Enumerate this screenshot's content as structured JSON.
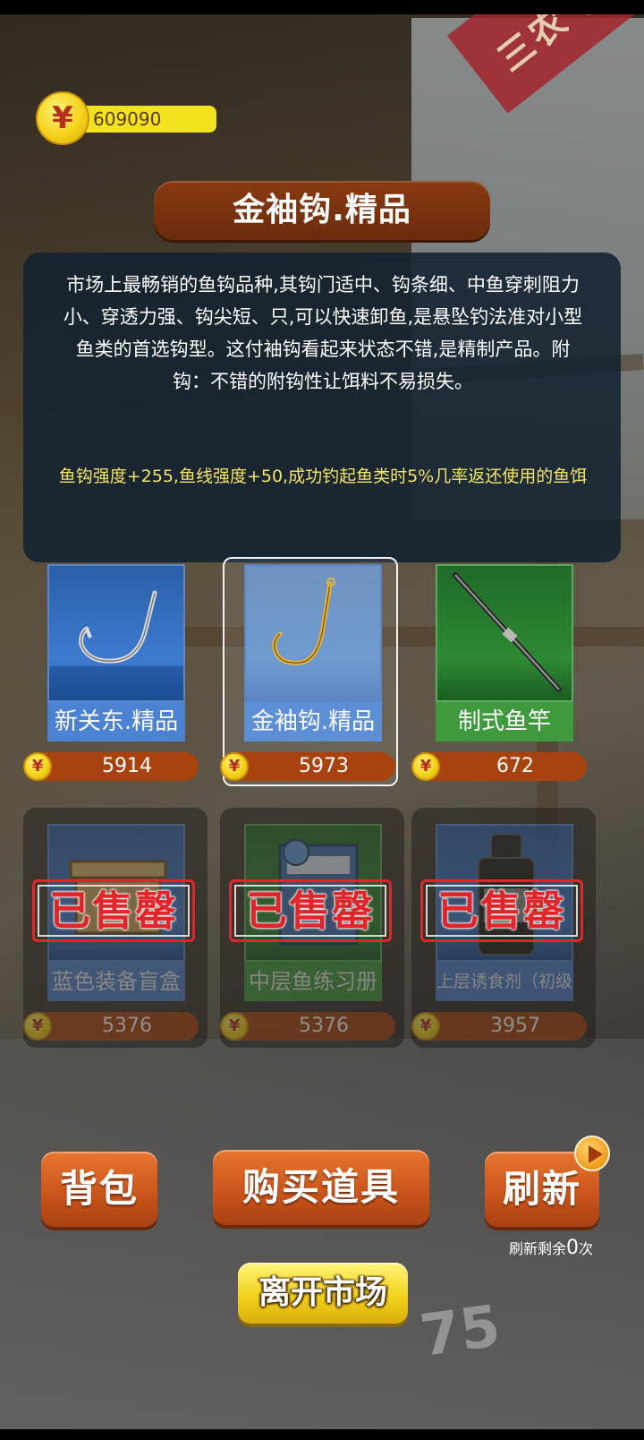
{
  "currency": {
    "icon": "yen-coin-icon",
    "symbol": "¥",
    "amount": "609090"
  },
  "background": {
    "banner_text": "三农 共同富",
    "floor_number": "75"
  },
  "item_detail": {
    "title": "金袖钩.精品",
    "description": "市场上最畅销的鱼钩品种,其钩门适中、钩条细、中鱼穿刺阻力小、穿透力强、钩尖短、只,可以快速卸鱼,是悬坠钓法准对小型鱼类的首选钩型。这付袖钩看起来状态不错,是精制产品。附钩：不错的附钩性让饵料不易损失。",
    "effect": "鱼钩强度+255,鱼线强度+50,成功钓起鱼类时5%几率返还使用的鱼饵"
  },
  "items": [
    {
      "name": "新关东.精品",
      "price": "5914",
      "icon": "silver-hook-icon",
      "sold": false,
      "selected": false
    },
    {
      "name": "金袖钩.精品",
      "price": "5973",
      "icon": "gold-hook-icon",
      "sold": false,
      "selected": true
    },
    {
      "name": "制式鱼竿",
      "price": "672",
      "icon": "fishing-rod-icon",
      "sold": false,
      "selected": false
    },
    {
      "name": "蓝色装备盲盒",
      "price": "5376",
      "icon": "blind-box-icon",
      "sold": true,
      "sold_label": "已售罄"
    },
    {
      "name": "中层鱼练习册",
      "price": "5376",
      "icon": "workbook-icon",
      "sold": true,
      "sold_label": "已售罄"
    },
    {
      "name": "上层诱食剂（初级",
      "price": "3957",
      "icon": "bait-bottle-icon",
      "sold": true,
      "sold_label": "已售罄"
    }
  ],
  "buttons": {
    "backpack": "背包",
    "buy": "购买道具",
    "refresh": "刷新",
    "refresh_badge_icon": "play-icon",
    "refresh_remaining_prefix": "刷新剩余",
    "refresh_remaining_count": "0",
    "refresh_remaining_suffix": "次",
    "leave": "离开市场"
  },
  "colors": {
    "title_plate": "#7a3310",
    "panel": "#122230",
    "effect_text": "#f3e36a",
    "price_bar": "#a8430f",
    "sold_stamp": "#e0262b",
    "button_orange": "#d45e22",
    "leave_yellow": "#f2d21c"
  }
}
